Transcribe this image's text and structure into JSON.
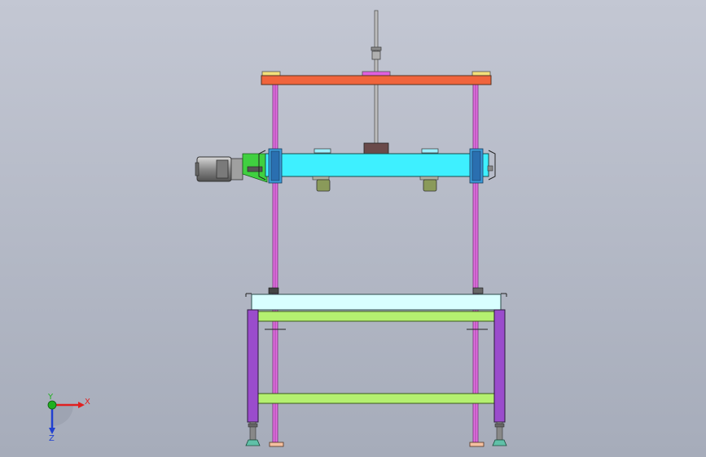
{
  "viewport": {
    "background_top": "#c3c7d3",
    "background_bottom": "#a6acba"
  },
  "triad": {
    "x_label": "X",
    "y_label": "Y",
    "z_label": "Z",
    "x_color": "#e02020",
    "y_color": "#20b020",
    "z_color": "#2040d0"
  },
  "colors": {
    "top_plate": "#f0643c",
    "top_pads": "#f2e07a",
    "top_center": "#e060e0",
    "guide_rods": "#e070e0",
    "carriage": "#3ef0ff",
    "motor_body": "#9a9a9a",
    "motor_mount": "#40d040",
    "lower_plate": "#d8ffff",
    "frame_rails": "#b4f070",
    "frame_legs": "#9a4ccc",
    "feet": "#60c0a8",
    "rod_bases": "#f4c0a0"
  }
}
